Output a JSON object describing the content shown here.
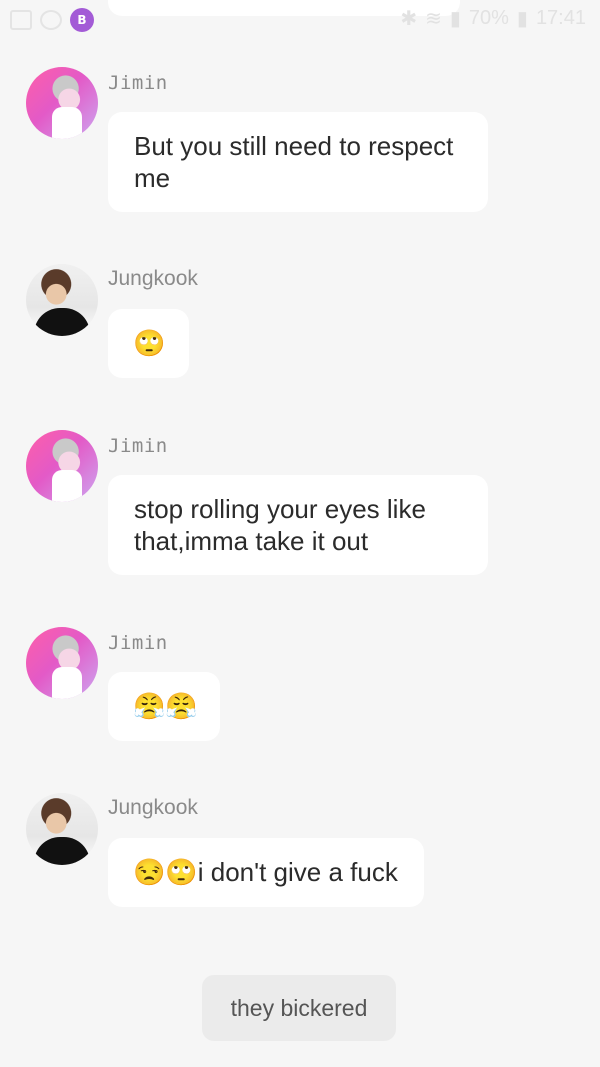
{
  "status_bar": {
    "battery": "70%",
    "time": "17:41",
    "app_icon_letter": "B"
  },
  "messages": [
    {
      "sender": "Jimin",
      "text": "But you still need to respect me"
    },
    {
      "sender": "Jungkook",
      "text": "🙄"
    },
    {
      "sender": "Jimin",
      "text": "stop rolling your eyes like that,imma take it out"
    },
    {
      "sender": "Jimin",
      "text": "😤😤"
    },
    {
      "sender": "Jungkook",
      "text": "😒🙄i don't give a fuck"
    }
  ],
  "narration": "they bickered"
}
